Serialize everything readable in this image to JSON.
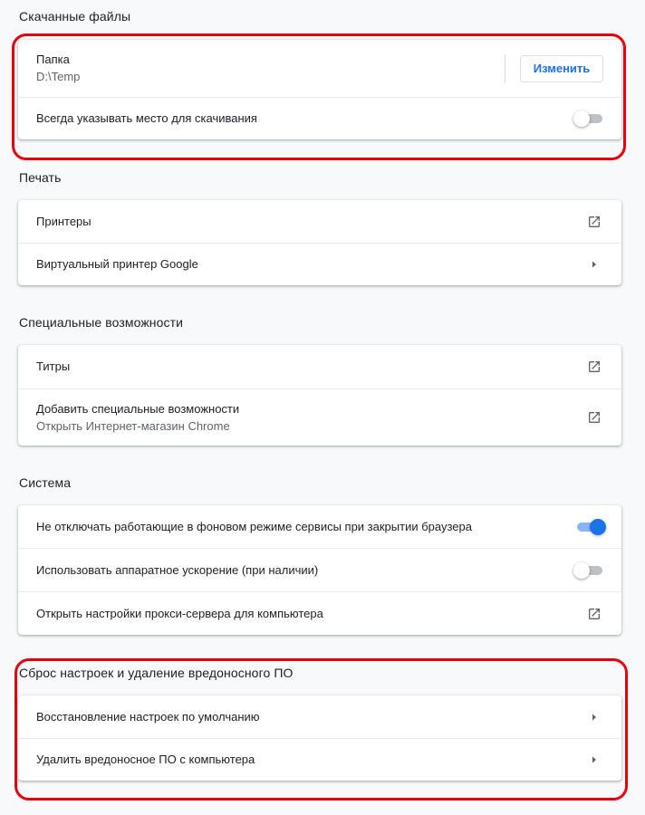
{
  "downloads": {
    "title": "Скачанные файлы",
    "folder_label": "Папка",
    "folder_path": "D:\\Temp",
    "change_button": "Изменить",
    "ask_location_label": "Всегда указывать место для скачивания",
    "ask_location_enabled": false
  },
  "printing": {
    "title": "Печать",
    "printers_label": "Принтеры",
    "cloud_print_label": "Виртуальный принтер Google"
  },
  "accessibility": {
    "title": "Специальные возможности",
    "captions_label": "Титры",
    "add_features_label": "Добавить специальные возможности",
    "add_features_sublabel": "Открыть Интернет-магазин Chrome"
  },
  "system": {
    "title": "Система",
    "background_apps_label": "Не отключать работающие в фоновом режиме сервисы при закрытии браузера",
    "background_apps_enabled": true,
    "hardware_accel_label": "Использовать аппаратное ускорение (при наличии)",
    "hardware_accel_enabled": false,
    "proxy_label": "Открыть настройки прокси-сервера для компьютера"
  },
  "reset": {
    "title": "Сброс настроек и удаление вредоносного ПО",
    "restore_defaults_label": "Восстановление настроек по умолчанию",
    "cleanup_label": "Удалить вредоносное ПО с компьютера"
  },
  "icons": {
    "external": "open-in-new-icon",
    "arrow": "arrow-right-icon"
  },
  "colors": {
    "accent": "#1a73e8",
    "highlight": "#e8000b"
  }
}
